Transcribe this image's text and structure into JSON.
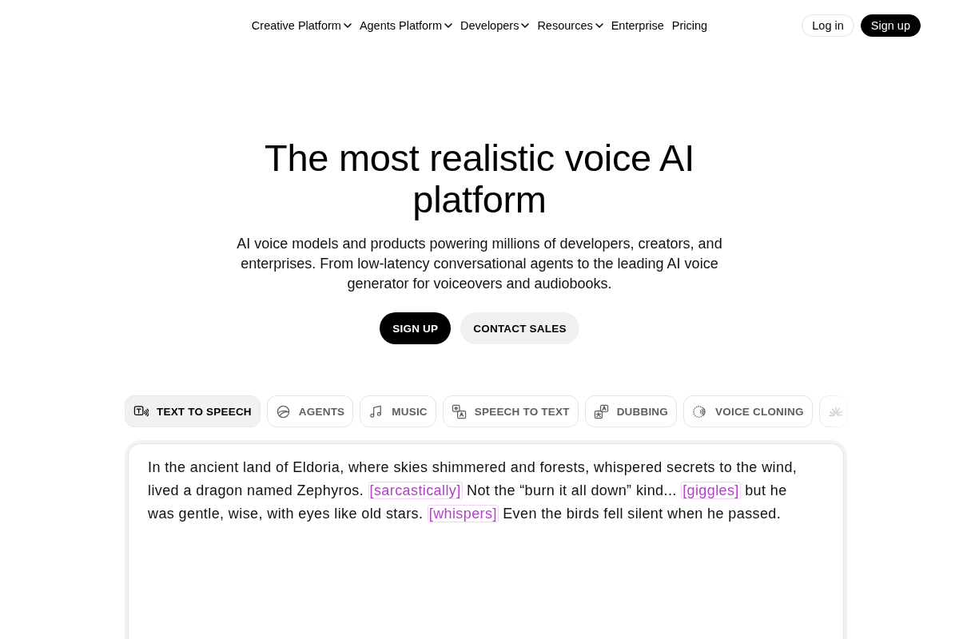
{
  "nav": {
    "links": [
      {
        "label": "Creative Platform",
        "dropdown": true
      },
      {
        "label": "Agents Platform",
        "dropdown": true
      },
      {
        "label": "Developers",
        "dropdown": true
      },
      {
        "label": "Resources",
        "dropdown": true
      },
      {
        "label": "Enterprise",
        "dropdown": false
      },
      {
        "label": "Pricing",
        "dropdown": false
      }
    ],
    "actions": [
      {
        "label": "Log in",
        "kind": "secondary"
      },
      {
        "label": "Sign up",
        "kind": "primary"
      }
    ]
  },
  "hero": {
    "title": "The most realistic voice AI platform",
    "subtitle": "AI voice models and products powering millions of developers, creators, and enterprises. From low-latency conversational agents to the leading AI voice generator for voiceovers and audiobooks.",
    "buttons": [
      {
        "label": "SIGN UP",
        "kind": "primary"
      },
      {
        "label": "CONTACT SALES",
        "kind": "secondary"
      }
    ]
  },
  "tabs": [
    {
      "label": "TEXT TO SPEECH",
      "selected": true
    },
    {
      "label": "AGENTS",
      "selected": false
    },
    {
      "label": "MUSIC",
      "selected": false
    },
    {
      "label": "SPEECH TO TEXT",
      "selected": false
    },
    {
      "label": "DUBBING",
      "selected": false
    },
    {
      "label": "VOICE CLONING",
      "selected": false
    },
    {
      "selected": false
    }
  ],
  "editor": {
    "segments": [
      {
        "kind": "text",
        "text": "In the ancient land of Eldoria, where skies shimmered and forests, whispered secrets to the wind, lived a dragon named Zephyros. "
      },
      {
        "kind": "tag",
        "text": "[sarcastically]"
      },
      {
        "kind": "text",
        "text": " Not the “burn it all down” kind... "
      },
      {
        "kind": "tag",
        "text": "[giggles]"
      },
      {
        "kind": "text",
        "text": " but he was gentle, wise, with eyes like old stars. "
      },
      {
        "kind": "tag",
        "text": "[whispers]"
      },
      {
        "kind": "text",
        "text": " Even the birds fell silent when he passed."
      }
    ]
  }
}
